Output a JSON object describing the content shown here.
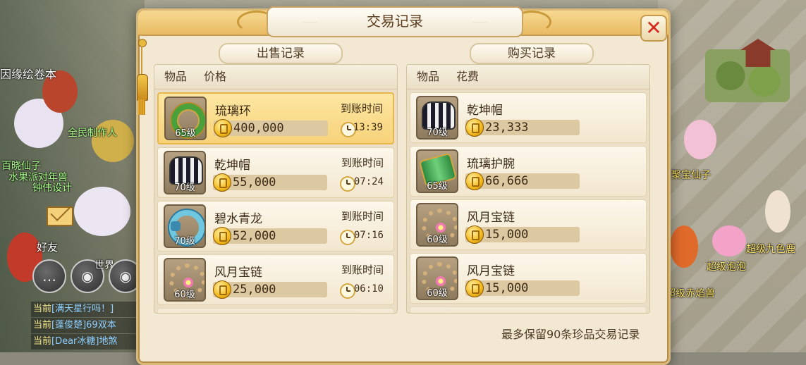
{
  "panel": {
    "title": "交易记录",
    "close_label": "✕",
    "footer_note": "最多保留90条珍品交易记录"
  },
  "sell": {
    "tab_label": "出售记录",
    "col_item": "物品",
    "col_price": "价格",
    "arrive_label": "到账时间",
    "rows": [
      {
        "name": "琉璃环",
        "level": "65级",
        "price": "400,000",
        "time": "13:39",
        "icon": "ring-icon"
      },
      {
        "name": "乾坤帽",
        "level": "70级",
        "price": "55,000",
        "time": "07:24",
        "icon": "hat-icon"
      },
      {
        "name": "碧水青龙",
        "level": "70级",
        "price": "52,000",
        "time": "07:16",
        "icon": "dragon-icon"
      },
      {
        "name": "风月宝链",
        "level": "60级",
        "price": "25,000",
        "time": "06:10",
        "icon": "chain-icon"
      }
    ]
  },
  "buy": {
    "tab_label": "购买记录",
    "col_item": "物品",
    "col_cost": "花费",
    "rows": [
      {
        "name": "乾坤帽",
        "level": "70级",
        "price": "23,333",
        "icon": "hat-icon"
      },
      {
        "name": "琉璃护腕",
        "level": "65级",
        "price": "66,666",
        "icon": "cuff-icon"
      },
      {
        "name": "风月宝链",
        "level": "60级",
        "price": "15,000",
        "icon": "chain-icon"
      },
      {
        "name": "风月宝链",
        "level": "60级",
        "price": "15,000",
        "icon": "chain-icon"
      }
    ]
  },
  "world": {
    "npc_labels": {
      "top_left": "因缘绘卷本",
      "left_1": "全民制作人",
      "left_2": "百晓仙子",
      "left_3": "水果派对年兽",
      "left_4": "钟伟设计",
      "friends": "好友",
      "world_chan": "世界",
      "right_1": "聚宝仙子",
      "right_2": "超级九色鹿",
      "right_3": "超级泡泡",
      "right_4": "超级赤焰兽"
    },
    "chat": [
      {
        "channel": "当前",
        "text": "[满天星行吗！]"
      },
      {
        "channel": "当前",
        "text": "[蓬俊楚]69双本"
      },
      {
        "channel": "当前",
        "text": "[Dear冰糖]地煞"
      }
    ]
  },
  "colors": {
    "panel_bg": "#f3e8d2",
    "selected_row": "#f7d27a",
    "close_x": "#d4291e"
  }
}
